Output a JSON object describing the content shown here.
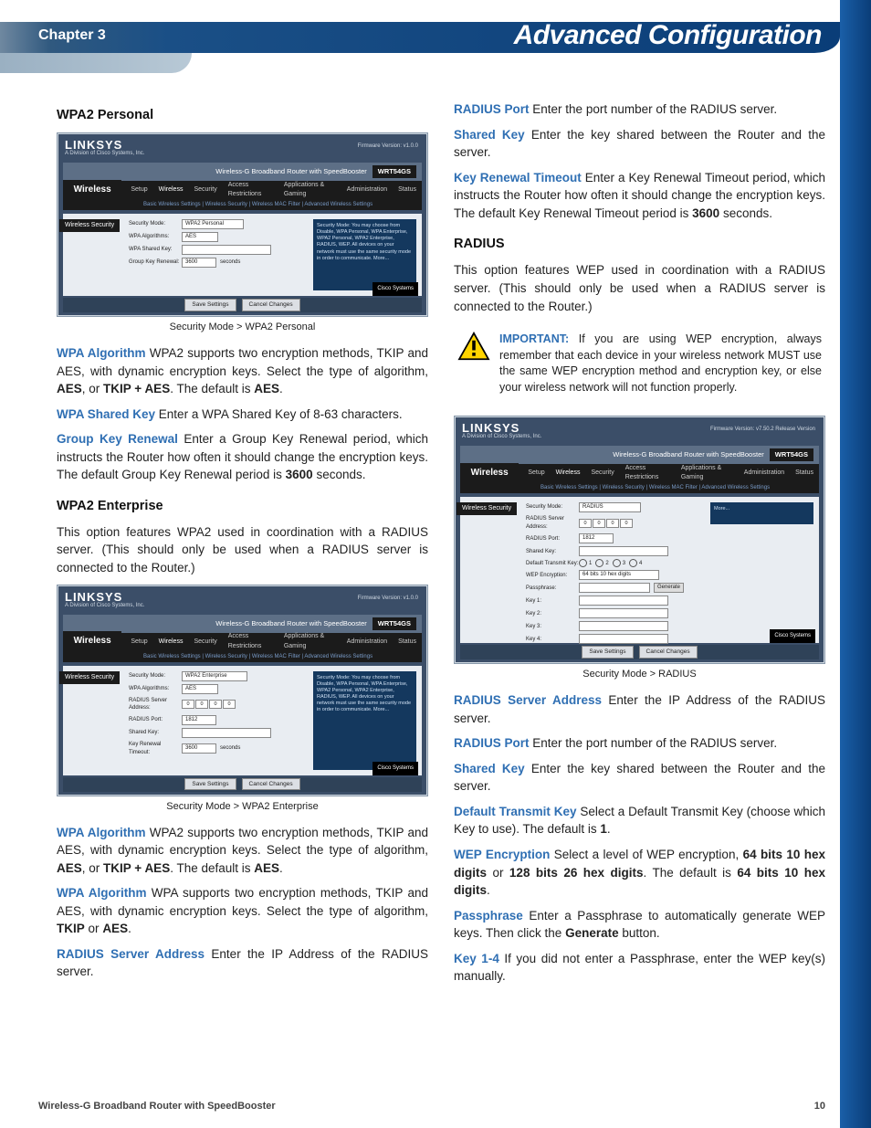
{
  "header": {
    "chapter": "Chapter 3",
    "title": "Advanced Configuration"
  },
  "footer": {
    "title": "Wireless-G Broadband Router with SpeedBooster",
    "page": "10"
  },
  "shot_common": {
    "brand": "LINKSYS",
    "brand_sub": "A Division of Cisco Systems, Inc.",
    "menu_label": "Wireless",
    "side_tab": "Wireless Security",
    "save": "Save Settings",
    "cancel": "Cancel Changes",
    "cisco": "Cisco Systems"
  },
  "shot1": {
    "topband": "Wireless-G Broadband Router with SpeedBooster",
    "model": "WRT54GS",
    "fw": "Firmware Version: v1.0.0",
    "menu": [
      "Setup",
      "Wireless",
      "Security",
      "Access Restrictions",
      "Applications & Gaming",
      "Administration",
      "Status"
    ],
    "submenu": "Basic Wireless Settings   |   Wireless Security   |   Wireless MAC Filter   |   Advanced Wireless Settings",
    "rows": {
      "mode_l": "Security Mode:",
      "mode_v": "WPA2 Personal",
      "alg_l": "WPA Algorithms:",
      "alg_v": "AES",
      "key_l": "WPA Shared Key:",
      "renew_l": "Group Key Renewal:",
      "renew_v": "3600",
      "renew_u": "seconds"
    },
    "help": "Security Mode: You may choose from Disable, WPA Personal, WPA Enterprise, WPA2 Personal, WPA2 Enterprise, RADIUS, WEP. All devices on your network must use the same security mode in order to communicate. More..."
  },
  "shot2": {
    "topband": "Wireless-G Broadband Router with SpeedBooster",
    "model": "WRT54GS",
    "fw": "Firmware Version: v1.0.0",
    "menu": [
      "Setup",
      "Wireless",
      "Security",
      "Access Restrictions",
      "Applications & Gaming",
      "Administration",
      "Status"
    ],
    "submenu": "Basic Wireless Settings   |   Wireless Security   |   Wireless MAC Filter   |   Advanced Wireless Settings",
    "rows": {
      "mode_l": "Security Mode:",
      "mode_v": "WPA2 Enterprise",
      "alg_l": "WPA Algorithms:",
      "alg_v": "AES",
      "addr_l": "RADIUS Server Address:",
      "port_l": "RADIUS Port:",
      "port_v": "1812",
      "skey_l": "Shared Key:",
      "to_l": "Key Renewal Timeout:",
      "to_v": "3600",
      "to_u": "seconds"
    },
    "help": "Security Mode: You may choose from Disable, WPA Personal, WPA Enterprise, WPA2 Personal, WPA2 Enterprise, RADIUS, WEP. All devices on your network must use the same security mode in order to communicate. More..."
  },
  "shot3": {
    "topband": "Wireless-G Broadband Router with SpeedBooster",
    "model": "WRT54GS",
    "fw": "Firmware Version: v7.50.2 Release Version",
    "menu": [
      "Setup",
      "Wireless",
      "Security",
      "Access Restrictions",
      "Applications & Gaming",
      "Administration",
      "Status"
    ],
    "submenu": "Basic Wireless Settings   |   Wireless Security   |   Wireless MAC Filter   |   Advanced Wireless Settings",
    "rows": {
      "mode_l": "Security Mode:",
      "mode_v": "RADIUS",
      "addr_l": "RADIUS Server Address:",
      "port_l": "RADIUS Port:",
      "port_v": "1812",
      "skey_l": "Shared Key:",
      "dtk_l": "Default Transmit Key:",
      "dtk_v1": "1",
      "dtk_v2": "2",
      "dtk_v3": "3",
      "dtk_v4": "4",
      "wep_l": "WEP Encryption:",
      "wep_v": "64 bits 10 hex digits",
      "pass_l": "Passphrase:",
      "gen": "Generate",
      "k1": "Key 1:",
      "k2": "Key 2:",
      "k3": "Key 3:",
      "k4": "Key 4:"
    },
    "help": "More..."
  },
  "left": {
    "h_wpa2p": "WPA2 Personal",
    "cap1": "Security Mode > WPA2 Personal",
    "p1a": "WPA Algorithm",
    "p1b": "WPA2 supports two encryption methods, TKIP and AES, with dynamic encryption keys. Select the type of algorithm,",
    "p1c": "AES",
    "p1d": ", or",
    "p1e": "TKIP + AES",
    "p1f": ". The default is",
    "p1g": "AES",
    "p1h": ".",
    "p2a": "WPA Shared Key",
    "p2b": "Enter a WPA Shared Key of 8-63 characters.",
    "p3a": "Group Key Renewal",
    "p3b": "Enter a Group Key Renewal period, which instructs the Router how often it should change the encryption keys. The default Group Key Renewal period is",
    "p3c": "3600",
    "p3d": "seconds.",
    "h_wpa2e": "WPA2 Enterprise",
    "p4": "This option features WPA2 used in coordination with a RADIUS server. (This should only be used when a RADIUS server is connected to the Router.)",
    "cap2": "Security Mode > WPA2 Enterprise",
    "p5a": "WPA Algorithm",
    "p5b": "WPA2 supports two encryption methods, TKIP and AES, with dynamic encryption keys. Select the type of algorithm,",
    "p5c": "AES",
    "p5d": ", or",
    "p5e": "TKIP + AES",
    "p5f": ". The default is",
    "p5g": "AES",
    "p5h": ".",
    "p6a": "WPA Algorithm",
    "p6b": "WPA supports two encryption methods, TKIP and AES, with dynamic encryption keys. Select the type of algorithm,",
    "p6c": "TKIP",
    "p6d": "or",
    "p6e": "AES",
    "p6f": ".",
    "p7a": "RADIUS Server Address",
    "p7b": "Enter the IP Address of the RADIUS server."
  },
  "right": {
    "p1a": "RADIUS Port",
    "p1b": "Enter the port number of the RADIUS server.",
    "p2a": "Shared Key",
    "p2b": "Enter the key shared between the Router and the server.",
    "p3a": "Key Renewal Timeout",
    "p3b": "Enter a Key Renewal Timeout period, which instructs the Router how often it should change the encryption keys. The default Key Renewal Timeout period is",
    "p3c": "3600",
    "p3d": "seconds.",
    "h_radius": "RADIUS",
    "p4": "This option features WEP used in coordination with a RADIUS server. (This should only be used when a RADIUS server is connected to the Router.)",
    "imp_t": "IMPORTANT:",
    "imp_b": "If you are using WEP encryption, always remember that each device in your wireless network MUST use the same WEP encryption method and encryption key, or else your wireless network will not function properly.",
    "cap3": "Security Mode > RADIUS",
    "p5a": "RADIUS Server Address",
    "p5b": "Enter the IP Address of the RADIUS server.",
    "p6a": "RADIUS Port",
    "p6b": "Enter the port number of the RADIUS server.",
    "p7a": "Shared Key",
    "p7b": "Enter the key shared between the Router and the server.",
    "p8a": "Default Transmit Key",
    "p8b": "Select a Default Transmit Key (choose which Key to use). The default is",
    "p8c": "1",
    "p8d": ".",
    "p9a": "WEP Encryption",
    "p9b": "Select a level of WEP encryption,",
    "p9c": "64 bits 10 hex digits",
    "p9d": "or",
    "p9e": "128 bits 26 hex digits",
    "p9f": ". The default is",
    "p9g": "64 bits 10 hex digits",
    "p9h": ".",
    "p10a": "Passphrase",
    "p10b": "Enter a Passphrase to automatically generate WEP keys. Then click the",
    "p10c": "Generate",
    "p10d": "button.",
    "p11a": "Key 1-4",
    "p11b": "If you did not enter a Passphrase, enter the WEP key(s) manually."
  }
}
